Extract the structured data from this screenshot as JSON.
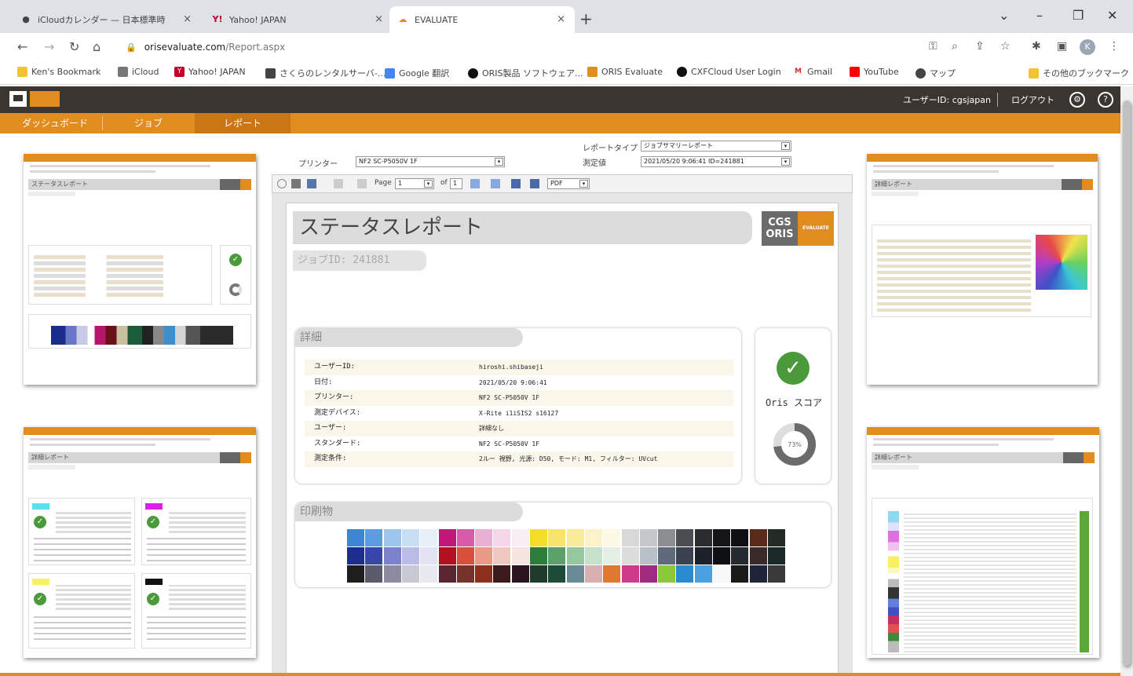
{
  "browser": {
    "tabs": [
      {
        "label": "iCloudカレンダー — 日本標準時",
        "icon": "apple-icon"
      },
      {
        "label": "Yahoo! JAPAN",
        "icon": "yahoo-icon"
      },
      {
        "label": "EVALUATE",
        "icon": "cloud-icon"
      }
    ],
    "url_host": "orisevaluate.com",
    "url_path": "/Report.aspx",
    "bookmarks": [
      "Ken's Bookmark",
      "iCloud",
      "Yahoo! JAPAN",
      "さくらのレンタルサーバ-...",
      "Google 翻訳",
      "ORIS製品 ソフトウェア...",
      "ORIS Evaluate",
      "CXFCloud User Login",
      "Gmail",
      "YouTube",
      "マップ",
      "その他のブックマーク"
    ],
    "profile_initial": "K"
  },
  "app": {
    "user_label": "ユーザーID: cgsjapan",
    "logout": "ログアウト",
    "nav": [
      "ダッシュボード",
      "ジョブ",
      "レポート"
    ],
    "colors": {
      "accent": "#e08c1e",
      "dark": "#3a3530",
      "ok": "#4a9a3c"
    }
  },
  "report_controls": {
    "printer_label": "プリンター",
    "printer_value": "NF2 SC-P5050V 1F",
    "report_type_label": "レポートタイプ",
    "report_type_value": "ジョブサマリーレポート",
    "measure_label": "測定値",
    "measure_value": "2021/05/20 9:06:41 ID=241881",
    "page_label": "Page",
    "page_value": "1",
    "of_label": "of",
    "page_total": "1",
    "export_value": "PDF"
  },
  "report": {
    "title": "ステータスレポート",
    "logo_top": "CGS",
    "logo_bottom": "ORIS",
    "logo_right": "EVALUATE",
    "job_id": "ジョブID: 241881",
    "detail_title": "詳細",
    "detail_rows": [
      {
        "k": "ユーザーID:",
        "v": "hiroshi.shibaseji"
      },
      {
        "k": "日付:",
        "v": "2021/05/20 9:06:41"
      },
      {
        "k": "プリンター:",
        "v": "NF2 SC-P5050V 1F"
      },
      {
        "k": "測定デバイス:",
        "v": "X-Rite i1iSIS2 s16127"
      },
      {
        "k": "ユーザー:",
        "v": "詳細なし"
      },
      {
        "k": "スタンダード:",
        "v": "NF2 SC-P5050V 1F"
      },
      {
        "k": "測定条件:",
        "v": "2ルー 視野, 光源: D50, モード: M1, フィルター: UVcut"
      }
    ],
    "score_label": "Oris スコア",
    "score_value": "73%",
    "score_fraction": 0.73,
    "print_title": "印刷物"
  },
  "thumbnails": {
    "status_title": "ステータスレポート",
    "detail_title": "詳細レポート"
  }
}
